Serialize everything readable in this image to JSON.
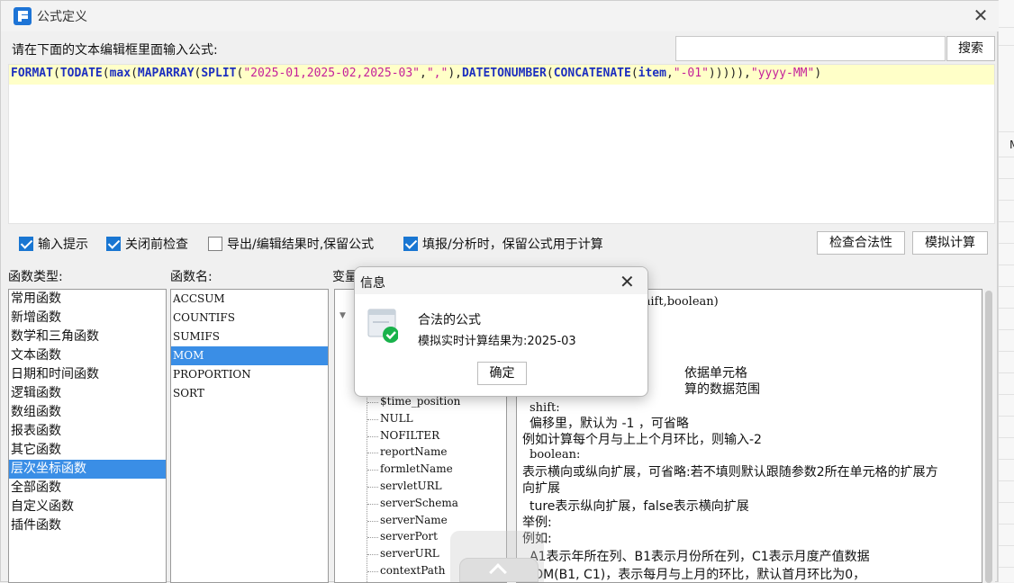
{
  "window": {
    "title": "公式定义"
  },
  "editor": {
    "prompt": "请在下面的文本编辑框里面输入公式:",
    "formula_tokens": [
      {
        "t": "FORMAT",
        "k": "fn"
      },
      {
        "t": "(",
        "k": "pl"
      },
      {
        "t": "TODATE",
        "k": "fn"
      },
      {
        "t": "(",
        "k": "pl"
      },
      {
        "t": "max",
        "k": "fn"
      },
      {
        "t": "(",
        "k": "pl"
      },
      {
        "t": "MAPARRAY",
        "k": "fn"
      },
      {
        "t": "(",
        "k": "pl"
      },
      {
        "t": "SPLIT",
        "k": "fn"
      },
      {
        "t": "(",
        "k": "pl"
      },
      {
        "t": "\"2025-01,2025-02,2025-03\"",
        "k": "str"
      },
      {
        "t": ",",
        "k": "pl"
      },
      {
        "t": "\",\"",
        "k": "str"
      },
      {
        "t": "),",
        "k": "pl"
      },
      {
        "t": "DATETONUMBER",
        "k": "fn"
      },
      {
        "t": "(",
        "k": "pl"
      },
      {
        "t": "CONCATENATE",
        "k": "fn"
      },
      {
        "t": "(",
        "k": "pl"
      },
      {
        "t": "item",
        "k": "fn"
      },
      {
        "t": ",",
        "k": "pl"
      },
      {
        "t": "\"-01\"",
        "k": "str"
      },
      {
        "t": "))))),",
        "k": "pl"
      },
      {
        "t": "\"yyyy-MM\"",
        "k": "str"
      },
      {
        "t": ")",
        "k": "pl"
      }
    ]
  },
  "search": {
    "value": "",
    "button_label": "搜索"
  },
  "options": {
    "input_hint": {
      "label": "输入提示",
      "checked": true
    },
    "check_before_close": {
      "label": "关闭前检查",
      "checked": true
    },
    "keep_formula_export": {
      "label": "导出/编辑结果时,保留公式",
      "checked": false
    },
    "keep_formula_fill": {
      "label": "填报/分析时，保留公式用于计算",
      "checked": true
    }
  },
  "buttons": {
    "validate": "检查合法性",
    "simulate": "模拟计算"
  },
  "function_types": {
    "label": "函数类型:",
    "items": [
      "常用函数",
      "新增函数",
      "数学和三角函数",
      "文本函数",
      "日期和时间函数",
      "逻辑函数",
      "数组函数",
      "报表函数",
      "其它函数",
      "层次坐标函数",
      "全部函数",
      "自定义函数",
      "插件函数"
    ],
    "selected_index": 9
  },
  "function_names": {
    "label": "函数名:",
    "items": [
      "ACCSUM",
      "COUNTIFS",
      "SUMIFS",
      "MOM",
      "PROPORTION",
      "SORT"
    ],
    "selected_index": 3
  },
  "variables": {
    "label": "变量",
    "items": [
      "$time_position",
      "NULL",
      "NOFILTER",
      "reportName",
      "formletName",
      "servletURL",
      "serverSchema",
      "serverName",
      "serverPort",
      "serverURL",
      "contextPath"
    ]
  },
  "description": {
    "lines": [
      "hift,boolean)",
      "依据单元格",
      "算的数据范围",
      "shift:",
      "偏移里，默认为 -1 ，可省略",
      "例如计算每个月与上上个月环比，则输入-2",
      "boolean:",
      "表示横向或纵向扩展，可省略:若不填则默认跟随参数2所在单元格的扩展方",
      "向扩展",
      "ture表示纵向扩展，false表示横向扩展",
      "举例:",
      "例如:",
      "A1表示年所在列、B1表示月份所在列，C1表示月度产值数据",
      "MOM(B1, C1)，表示每月与上月的环比，默认首月环比为0，"
    ]
  },
  "dialog": {
    "title": "信息",
    "message": "合法的公式",
    "result": "模拟实时计算结果为:2025-03",
    "ok_label": "确定"
  },
  "outer": {
    "right_edge_text": "M"
  }
}
